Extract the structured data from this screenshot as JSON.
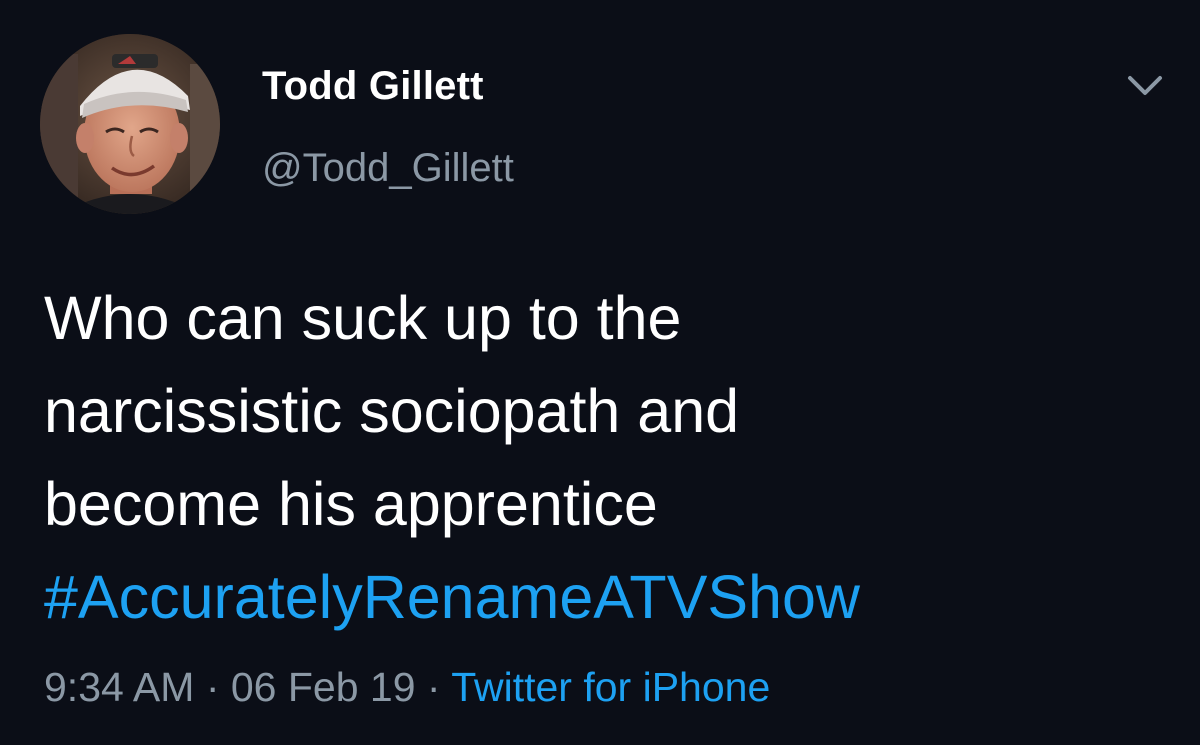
{
  "user": {
    "display_name": "Todd Gillett",
    "handle": "@Todd_Gillett",
    "avatar_icon": "profile-photo"
  },
  "menu": {
    "icon": "chevron-down-icon"
  },
  "tweet": {
    "lines": [
      "Who can suck up to the",
      "narcissistic sociopath and",
      "become his apprentice"
    ],
    "hashtag": "#AccuratelyRenameATVShow"
  },
  "meta": {
    "time": "9:34 AM",
    "separator_1": " · ",
    "date": "06 Feb 19",
    "separator_2": " · ",
    "source": "Twitter for iPhone"
  },
  "colors": {
    "background": "#0b0e17",
    "text": "#ffffff",
    "secondary": "#8b98a5",
    "link": "#1da1f2"
  }
}
